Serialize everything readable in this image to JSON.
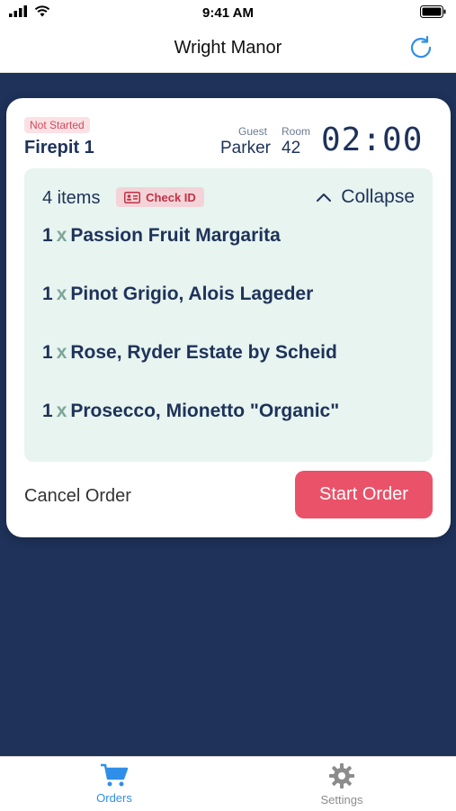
{
  "status_bar": {
    "time": "9:41 AM"
  },
  "header": {
    "title": "Wright Manor"
  },
  "order": {
    "status": "Not Started",
    "location": "Firepit 1",
    "guest_label": "Guest",
    "guest_name": "Parker",
    "room_label": "Room",
    "room_number": "42",
    "timer": "02:00",
    "item_count": "4 items",
    "check_id_label": "Check ID",
    "collapse_label": "Collapse",
    "items": [
      {
        "qty": "1",
        "x": "x",
        "name": "Passion Fruit Margarita"
      },
      {
        "qty": "1",
        "x": "x",
        "name": "Pinot Grigio, Alois Lageder"
      },
      {
        "qty": "1",
        "x": "x",
        "name": "Rose, Ryder Estate by Scheid"
      },
      {
        "qty": "1",
        "x": "x",
        "name": "Prosecco, Mionetto \"Organic\""
      }
    ],
    "cancel_label": "Cancel Order",
    "start_label": "Start Order"
  },
  "tabs": [
    {
      "label": "Orders",
      "icon": "cart-icon",
      "active": true
    },
    {
      "label": "Settings",
      "icon": "gear-icon",
      "active": false
    }
  ],
  "colors": {
    "navy": "#1e325a",
    "accent_red": "#ea5269",
    "active_tab": "#2f8fe8",
    "inactive_tab": "#8c8c8c",
    "items_bg": "#e7f4ef"
  }
}
